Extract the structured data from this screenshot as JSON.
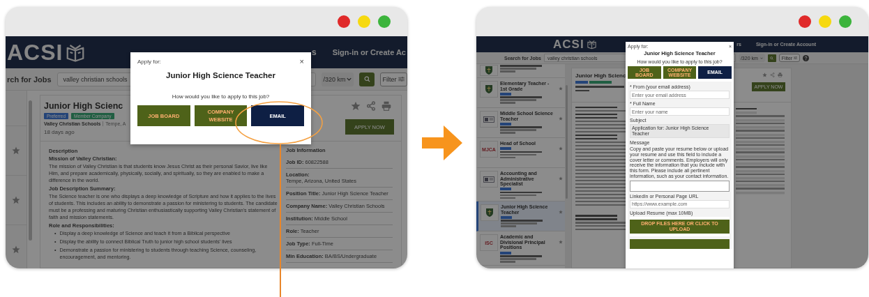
{
  "left_screen": {
    "header": {
      "logo": "ACSI",
      "nav_fragment": "s",
      "sign_in": "Sign-in or Create Ac"
    },
    "search": {
      "label": "rch for Jobs",
      "value": "valley christian schools",
      "distance": "/320 km",
      "filter": "Filter"
    },
    "job": {
      "title": "Junior High Scienc",
      "tags": [
        {
          "label": "Preferred",
          "kind": "preferred"
        },
        {
          "label": "Member Company",
          "kind": "member"
        }
      ],
      "company": "Valley Christian Schools",
      "location": "Tempe, A",
      "posted": "18 days ago",
      "apply": "APPLY NOW"
    },
    "description": [
      {
        "kind": "heading",
        "text": "Description"
      },
      {
        "kind": "heading",
        "text": "Mission of Valley Christian:"
      },
      {
        "kind": "paragraph",
        "text": "The mission of Valley Christian is that students know Jesus Christ as their personal Savior, live like Him, and prepare academically, physically, socially, and spiritually, so they are enabled to make a difference in the world."
      },
      {
        "kind": "heading",
        "text": "Job Description Summary:"
      },
      {
        "kind": "paragraph",
        "text": "The Science teacher is one who displays a deep knowledge of Scripture and how it applies to the lives of students.  This includes an ability to demonstrate a passion for ministering to students.  The candidate must be a professing and maturing Christian enthusiastically supporting Valley Christian's statement of faith and mission statements."
      },
      {
        "kind": "heading",
        "text": "Role and Responsibilities:"
      },
      {
        "kind": "bullets",
        "marker": "•",
        "items": [
          "Display a deep knowledge of Science and teach it from a Biblical perspective",
          "Display the ability to connect Biblical Truth to junior high school students' lives",
          "Demonstrate a passion for ministering to students through teaching Science, counseling, encouragement, and mentoring."
        ]
      }
    ],
    "job_info": {
      "heading": "Job Information",
      "items": [
        "**Job ID:** 60822588",
        "**Location:**\nTempe, Arizona, United States",
        "**Position Title:** Junior High Science Teacher",
        "**Company Name:** Valley Christian Schools",
        "**Institution:** Middle School",
        "**Role:** Teacher",
        "**Job Type:** Full-Time",
        "**Min Education:** BA/BS/Undergraduate"
      ]
    },
    "modal": {
      "caption": "Apply for:",
      "close": "×",
      "title": "Junior High Science Teacher",
      "question": "How would you like to apply to this job?",
      "options": [
        {
          "label": "JOB BOARD",
          "selected": false
        },
        {
          "label": "COMPANY WEBSITE",
          "selected": false
        },
        {
          "label": "EMAIL",
          "selected": true
        }
      ]
    }
  },
  "right_screen": {
    "header": {
      "logo": "ACSI",
      "nav_fragment": "rs",
      "sign_in": "Sign-in or Create Account"
    },
    "search": {
      "label": "Search for Jobs",
      "value": "valley christian schools",
      "distance": "/320 km",
      "filter": "Filter"
    },
    "list": [
      {
        "logo": {
          "kind": "shield"
        },
        "selected": false
      },
      {
        "title": "Elementary Teacher - 1st Grade",
        "preferred": true,
        "logo": {
          "kind": "shield"
        },
        "selected": false
      },
      {
        "title": "Middle School Science Teacher",
        "preferred": true,
        "logo": {
          "kind": "emblem"
        },
        "selected": false
      },
      {
        "title": "Head of School",
        "preferred": true,
        "logo": {
          "kind": "text",
          "text": "MJCA"
        },
        "selected": false
      },
      {
        "title": "Accounting and Administrative Specialist",
        "preferred": true,
        "logo": {
          "kind": "emblem"
        },
        "selected": false
      },
      {
        "title": "Junior High Science Teacher",
        "preferred": true,
        "logo": {
          "kind": "shield"
        },
        "selected": true
      },
      {
        "title": "Academic and Divisional Principal Positions",
        "preferred": true,
        "logo": {
          "kind": "text",
          "text": "iSC"
        },
        "selected": false
      }
    ],
    "job": {
      "title": "Junior High Scienc",
      "apply": "APPLY NOW"
    },
    "modal": {
      "caption": "Apply for:",
      "close": "×",
      "title": "Junior High Science Teacher",
      "question": "How would you like to apply to this job?",
      "options": [
        {
          "label": "JOB BOARD",
          "selected": false
        },
        {
          "label": "COMPANY WEBSITE",
          "selected": false
        },
        {
          "label": "EMAIL",
          "selected": true
        }
      ],
      "form": {
        "fields": [
          {
            "kind": "input",
            "label": "* From (your email address)",
            "placeholder": "Enter your email address",
            "disabled": false
          },
          {
            "kind": "input",
            "label": "* Full Name",
            "placeholder": "Enter your name",
            "disabled": false
          },
          {
            "kind": "input",
            "label": "Subject",
            "value": "Application for: Junior High Science Teacher",
            "disabled": true
          },
          {
            "kind": "textarea",
            "label": "Message",
            "help": "Copy and paste your resume below or upload your resume and use this field to include a cover letter or comments. Employers will only receive the information that you include with this form. Please include all pertinent information, such as your contact information."
          },
          {
            "kind": "input",
            "label": "LinkedIn or Personal Page URL",
            "placeholder": "https://www.example.com",
            "disabled": false
          },
          {
            "kind": "upload",
            "label": "Upload Resume (max 10MB)",
            "button": "DROP FILES HERE OR CLICK TO UPLOAD"
          }
        ]
      }
    }
  }
}
